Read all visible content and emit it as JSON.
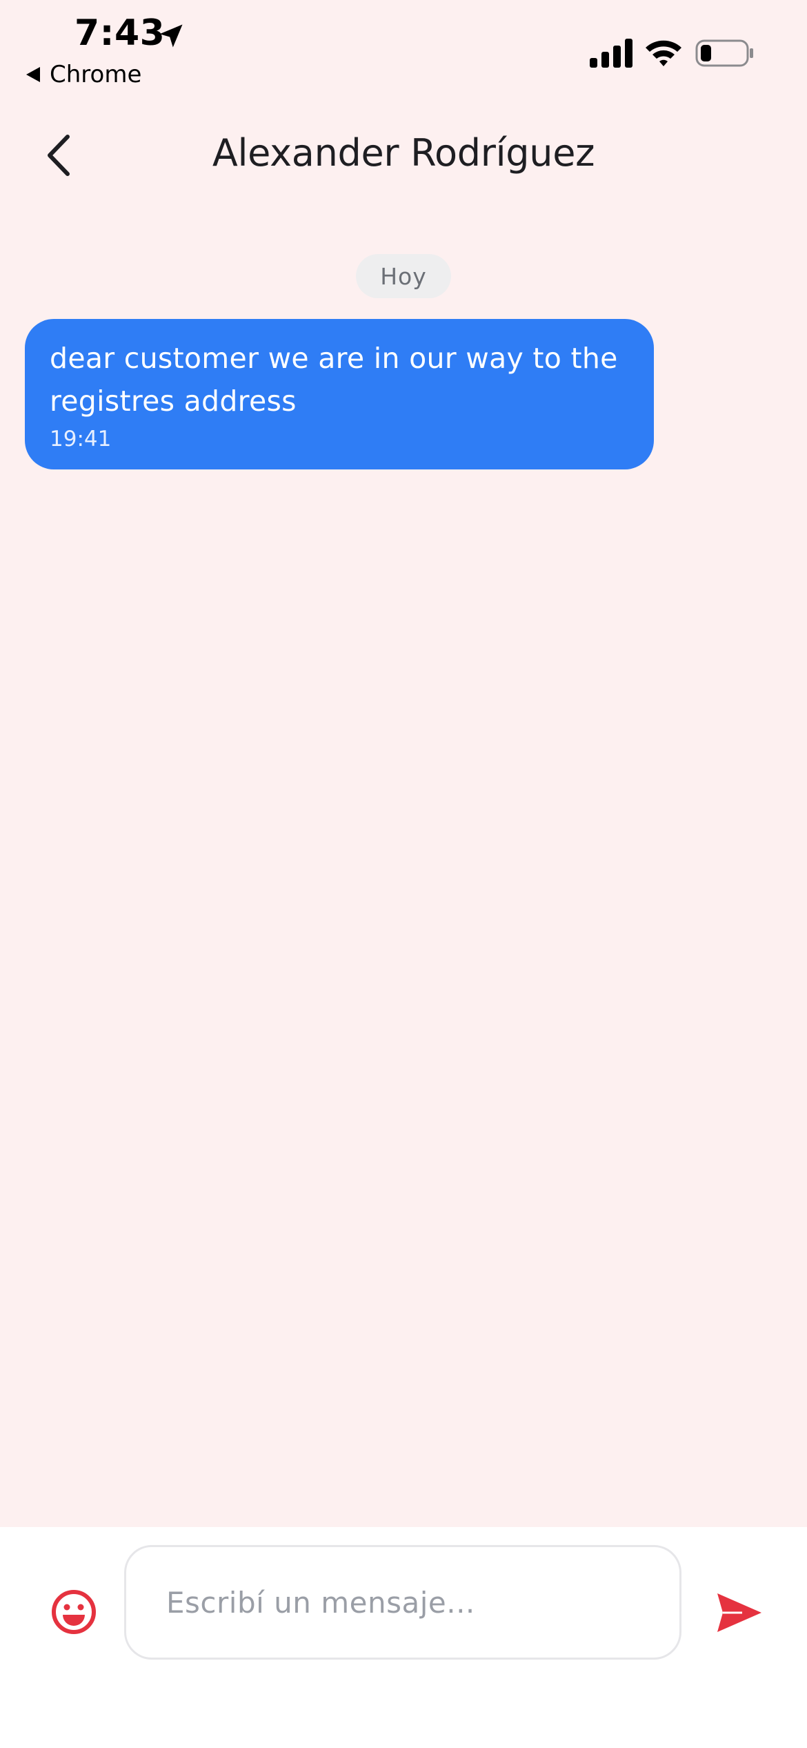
{
  "status_bar": {
    "time": "7:43",
    "back_app_label": "Chrome",
    "icons": [
      "location-arrow-icon",
      "cellular-signal-icon",
      "wifi-icon",
      "battery-icon"
    ]
  },
  "header": {
    "title": "Alexander Rodríguez",
    "back_icon": "chevron-left-icon"
  },
  "chat": {
    "date_label": "Hoy",
    "messages": [
      {
        "text": "dear customer we are in our way to the registres address",
        "time": "19:41"
      }
    ]
  },
  "composer": {
    "placeholder": "Escribí un mensaje...",
    "value": "",
    "emoji_icon": "emoji-smile-icon",
    "send_icon": "send-icon"
  },
  "colors": {
    "background": "#fdf0f0",
    "bubble": "#2f7df5",
    "accent_red": "#e5323f",
    "composer_bg": "#ffffff"
  }
}
